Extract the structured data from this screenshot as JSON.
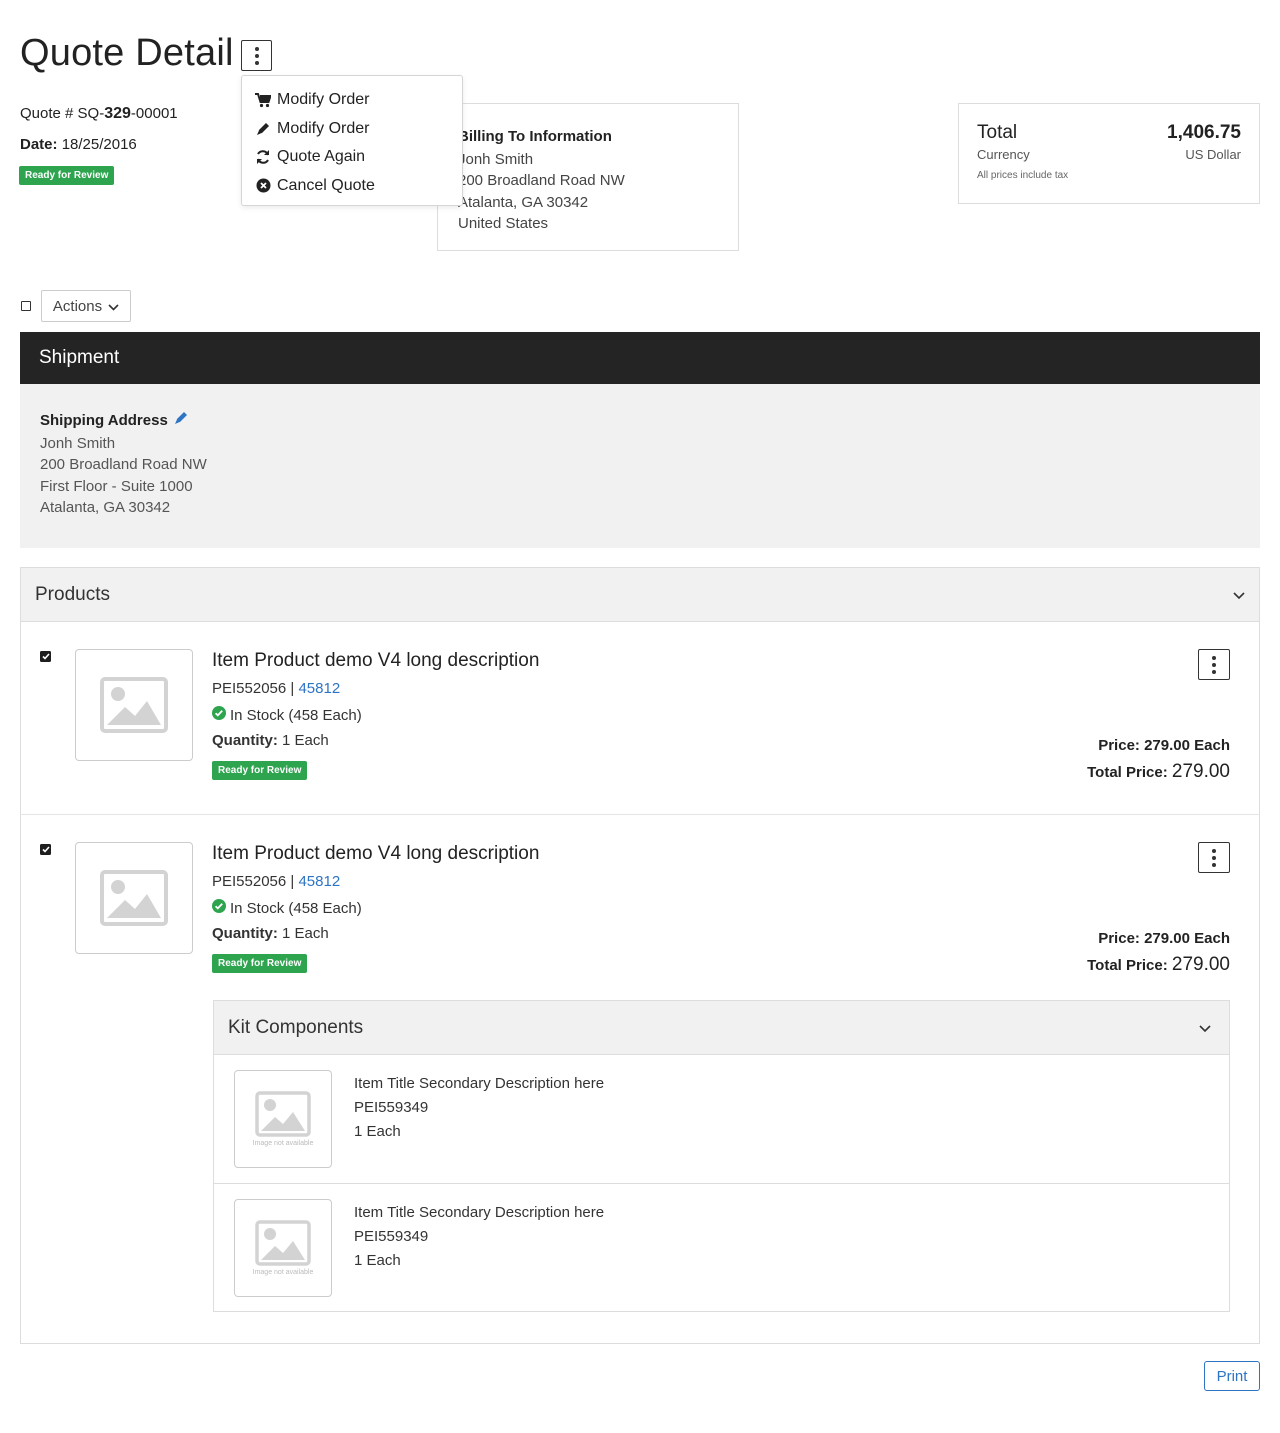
{
  "page": {
    "title": "Quote Detail"
  },
  "quote": {
    "number_prefix": "Quote # SQ-",
    "number_bold": "329",
    "number_suffix": "-00001",
    "date_label": "Date:",
    "date_value": "18/25/2016",
    "status": "Ready for Review"
  },
  "menu": {
    "items": [
      {
        "label": "Modify Order",
        "icon": "cart-icon"
      },
      {
        "label": "Modify Order",
        "icon": "pencil-icon"
      },
      {
        "label": "Quote Again",
        "icon": "refresh-icon"
      },
      {
        "label": "Cancel Quote",
        "icon": "cancel-circle-icon"
      }
    ]
  },
  "billing": {
    "title": "Billing To Information",
    "name": "Jonh Smith",
    "street": "200 Broadland Road NW",
    "city": "Atalanta, GA 30342",
    "country": "United States"
  },
  "total": {
    "label": "Total",
    "value": "1,406.75",
    "currency_label": "Currency",
    "currency_value": "US Dollar",
    "tax_note": "All prices include tax"
  },
  "actions": {
    "label": "Actions"
  },
  "shipment": {
    "title": "Shipment",
    "address_title": "Shipping Address",
    "name": "Jonh Smith",
    "street": "200 Broadland Road NW",
    "suite": "First Floor - Suite 1000",
    "city": "Atalanta, GA 30342"
  },
  "products": {
    "title": "Products",
    "items": [
      {
        "title": "Item Product demo V4 long description",
        "sku": "PEI552056",
        "sku_sep": " | ",
        "code": "45812",
        "stock": "In Stock (458 Each)",
        "qty_label": "Quantity:",
        "qty_value": "1 Each",
        "status": "Ready for Review",
        "price_label": "Price:",
        "price_value": "279.00 Each",
        "total_label": "Total Price:",
        "total_value": "279.00"
      },
      {
        "title": "Item Product demo V4 long description",
        "sku": "PEI552056",
        "sku_sep": " | ",
        "code": "45812",
        "stock": "In Stock (458 Each)",
        "qty_label": "Quantity:",
        "qty_value": "1 Each",
        "status": "Ready for Review",
        "price_label": "Price:",
        "price_value": "279.00 Each",
        "total_label": "Total Price:",
        "total_value": "279.00"
      }
    ]
  },
  "kit": {
    "title": "Kit Components",
    "image_na": "Image not available",
    "items": [
      {
        "title": "Item Title Secondary Description here",
        "sku": "PEI559349",
        "qty": "1 Each"
      },
      {
        "title": "Item Title Secondary Description here",
        "sku": "PEI559349",
        "qty": "1 Each"
      }
    ]
  },
  "print": {
    "label": "Print"
  },
  "colors": {
    "badge_green": "#2ea44f",
    "link_blue": "#2d74c4",
    "shipment_header": "#242424",
    "panel_gray": "#f1f1f1"
  }
}
